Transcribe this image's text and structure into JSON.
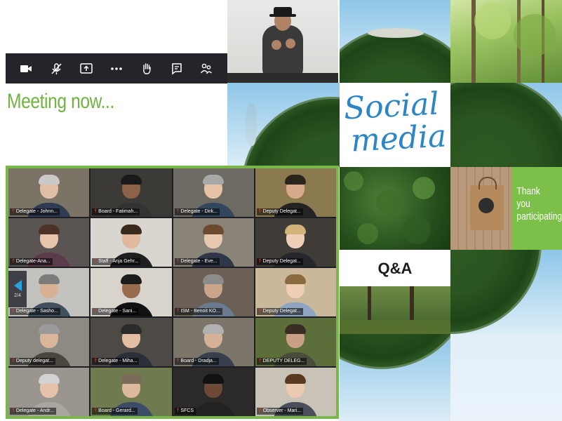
{
  "toolbar": {
    "buttons": [
      {
        "name": "video-camera",
        "icon": "camera-icon"
      },
      {
        "name": "mute-microphone",
        "icon": "mic-off-icon"
      },
      {
        "name": "share-screen",
        "icon": "share-screen-icon"
      },
      {
        "name": "more-options",
        "icon": "ellipsis-icon"
      },
      {
        "name": "raise-hand",
        "icon": "hand-icon"
      },
      {
        "name": "chat",
        "icon": "chat-icon"
      },
      {
        "name": "participants",
        "icon": "participants-icon"
      }
    ]
  },
  "headline": "Meeting now...",
  "gallery": {
    "page_indicator": "2/4",
    "participants": [
      {
        "name": "Delegate - Johnn..."
      },
      {
        "name": "Board - Fatimah..."
      },
      {
        "name": "Delegate - Dirk..."
      },
      {
        "name": "Deputy Delegat..."
      },
      {
        "name": "Delegate-Ana..."
      },
      {
        "name": "Staff - Anja Gehr..."
      },
      {
        "name": "Delegate - Eve..."
      },
      {
        "name": "Deputy Delegat..."
      },
      {
        "name": "Delegate - Sasho..."
      },
      {
        "name": "Delegate - Sani..."
      },
      {
        "name": "ISM - Benoit KO..."
      },
      {
        "name": "Deputy Delegat..."
      },
      {
        "name": "Deputy delegat..."
      },
      {
        "name": "Delegate - Miha..."
      },
      {
        "name": "Board - Dradja..."
      },
      {
        "name": "DEPUTY DELEG..."
      },
      {
        "name": "Delegate - Andr..."
      },
      {
        "name": "Board - Gerard..."
      },
      {
        "name": "SFCS"
      },
      {
        "name": "Observer - Mari..."
      }
    ]
  },
  "tiles": {
    "social_line1": "Social",
    "social_line2": "media",
    "qa": "Q&A",
    "thanks_line1": "Thank you",
    "thanks_line2": "participating"
  },
  "colors": {
    "accent_green": "#71b340",
    "frame_green": "#78b74a",
    "toolbar_bg": "#23252b"
  }
}
